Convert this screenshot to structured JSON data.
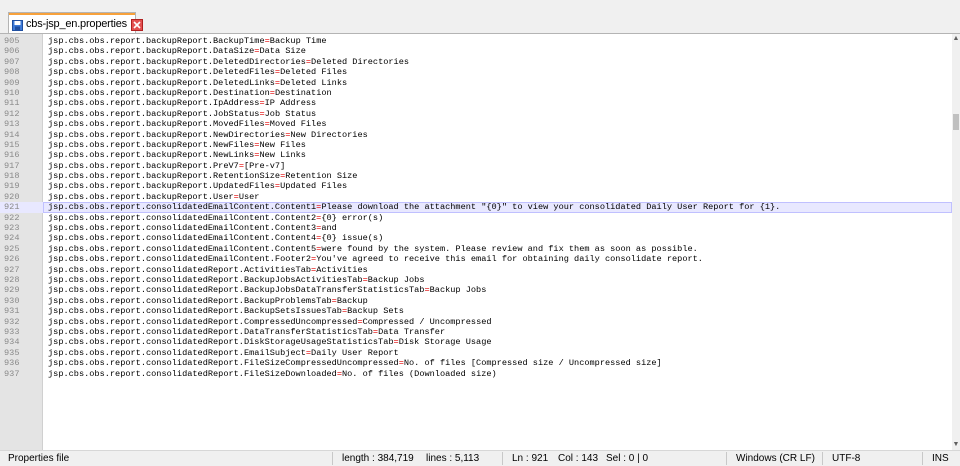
{
  "tab": {
    "label": "cbs-jsp_en.properties"
  },
  "editor": {
    "current_line": "921",
    "lines": [
      {
        "n": "905",
        "k": "jsp.cbs.obs.report.backupReport.BackupTime",
        "v": "Backup Time"
      },
      {
        "n": "906",
        "k": "jsp.cbs.obs.report.backupReport.DataSize",
        "v": "Data Size"
      },
      {
        "n": "907",
        "k": "jsp.cbs.obs.report.backupReport.DeletedDirectories",
        "v": "Deleted Directories"
      },
      {
        "n": "908",
        "k": "jsp.cbs.obs.report.backupReport.DeletedFiles",
        "v": "Deleted Files"
      },
      {
        "n": "909",
        "k": "jsp.cbs.obs.report.backupReport.DeletedLinks",
        "v": "Deleted Links"
      },
      {
        "n": "910",
        "k": "jsp.cbs.obs.report.backupReport.Destination",
        "v": "Destination"
      },
      {
        "n": "911",
        "k": "jsp.cbs.obs.report.backupReport.IpAddress",
        "v": "IP Address"
      },
      {
        "n": "912",
        "k": "jsp.cbs.obs.report.backupReport.JobStatus",
        "v": "Job Status"
      },
      {
        "n": "913",
        "k": "jsp.cbs.obs.report.backupReport.MovedFiles",
        "v": "Moved Files"
      },
      {
        "n": "914",
        "k": "jsp.cbs.obs.report.backupReport.NewDirectories",
        "v": "New Directories"
      },
      {
        "n": "915",
        "k": "jsp.cbs.obs.report.backupReport.NewFiles",
        "v": "New Files"
      },
      {
        "n": "916",
        "k": "jsp.cbs.obs.report.backupReport.NewLinks",
        "v": "New Links"
      },
      {
        "n": "917",
        "k": "jsp.cbs.obs.report.backupReport.PreV7",
        "v": "[Pre-v7]"
      },
      {
        "n": "918",
        "k": "jsp.cbs.obs.report.backupReport.RetentionSize",
        "v": "Retention Size"
      },
      {
        "n": "919",
        "k": "jsp.cbs.obs.report.backupReport.UpdatedFiles",
        "v": "Updated Files"
      },
      {
        "n": "920",
        "k": "jsp.cbs.obs.report.backupReport.User",
        "v": "User"
      },
      {
        "n": "921",
        "k": "jsp.cbs.obs.report.consolidatedEmailContent.Content1",
        "v": "Please download the attachment \"{0}\" to view your consolidated Daily User Report for {1}."
      },
      {
        "n": "922",
        "k": "jsp.cbs.obs.report.consolidatedEmailContent.Content2",
        "v": "{0} error(s)"
      },
      {
        "n": "923",
        "k": "jsp.cbs.obs.report.consolidatedEmailContent.Content3",
        "v": "and"
      },
      {
        "n": "924",
        "k": "jsp.cbs.obs.report.consolidatedEmailContent.Content4",
        "v": "{0} issue(s)"
      },
      {
        "n": "925",
        "k": "jsp.cbs.obs.report.consolidatedEmailContent.Content5",
        "v": "were found by the system. Please review and fix them as soon as possible."
      },
      {
        "n": "926",
        "k": "jsp.cbs.obs.report.consolidatedEmailContent.Footer2",
        "v": "You've agreed to receive this email for obtaining daily consolidate report."
      },
      {
        "n": "927",
        "k": "jsp.cbs.obs.report.consolidatedReport.ActivitiesTab",
        "v": "Activities"
      },
      {
        "n": "928",
        "k": "jsp.cbs.obs.report.consolidatedReport.BackupJobsActivitiesTab",
        "v": "Backup Jobs"
      },
      {
        "n": "929",
        "k": "jsp.cbs.obs.report.consolidatedReport.BackupJobsDataTransferStatisticsTab",
        "v": "Backup Jobs"
      },
      {
        "n": "930",
        "k": "jsp.cbs.obs.report.consolidatedReport.BackupProblemsTab",
        "v": "Backup"
      },
      {
        "n": "931",
        "k": "jsp.cbs.obs.report.consolidatedReport.BackupSetsIssuesTab",
        "v": "Backup Sets"
      },
      {
        "n": "932",
        "k": "jsp.cbs.obs.report.consolidatedReport.CompressedUncompressed",
        "v": "Compressed / Uncompressed"
      },
      {
        "n": "933",
        "k": "jsp.cbs.obs.report.consolidatedReport.DataTransferStatisticsTab",
        "v": "Data Transfer"
      },
      {
        "n": "934",
        "k": "jsp.cbs.obs.report.consolidatedReport.DiskStorageUsageStatisticsTab",
        "v": "Disk Storage Usage"
      },
      {
        "n": "935",
        "k": "jsp.cbs.obs.report.consolidatedReport.EmailSubject",
        "v": "Daily User Report"
      },
      {
        "n": "936",
        "k": "jsp.cbs.obs.report.consolidatedReport.FileSizeCompressedUncompressed",
        "v": "No. of files [Compressed size / Uncompressed size]"
      },
      {
        "n": "937",
        "k": "jsp.cbs.obs.report.consolidatedReport.FileSizeDownloaded",
        "v": "No. of files (Downloaded size)"
      }
    ]
  },
  "status": {
    "file_type": "Properties file",
    "length": "length : 384,719",
    "lines": "lines : 5,113",
    "ln": "Ln : 921",
    "col": "Col : 143",
    "sel": "Sel : 0 | 0",
    "eol": "Windows (CR LF)",
    "encoding": "UTF-8",
    "mode": "INS"
  },
  "colors": {
    "tab_accent": "#f7a13b",
    "equals": "#e00000",
    "current_line_bg": "#e8e8ff",
    "gutter_bg": "#e4e4e4"
  },
  "icons": {
    "tab_file": "save-icon",
    "tab_close": "close-icon"
  }
}
